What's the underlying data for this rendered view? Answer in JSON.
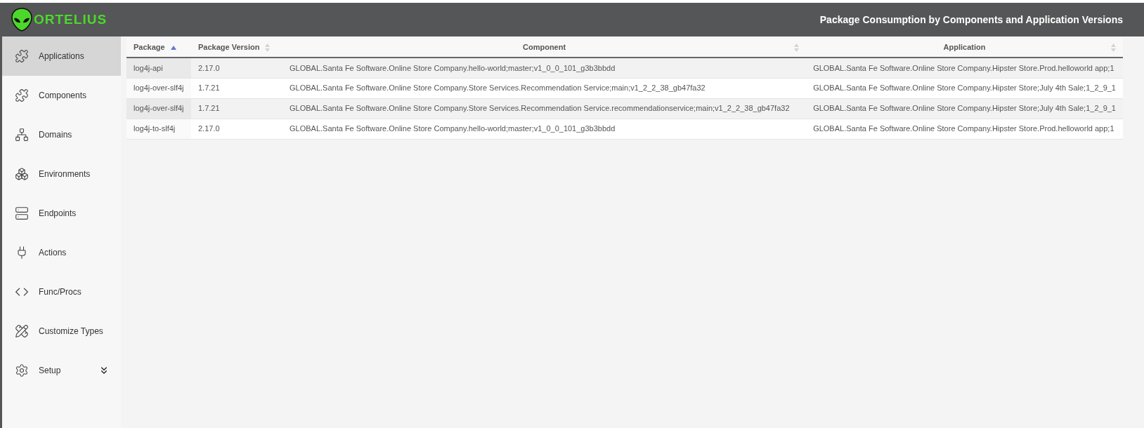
{
  "logo": {
    "text": "ORTELIUS"
  },
  "header": {
    "title": "Package Consumption by Components and Application Versions"
  },
  "sidebar": {
    "items": [
      {
        "kind": "applications",
        "label": "Applications",
        "selected": true
      },
      {
        "kind": "components",
        "label": "Components",
        "selected": false
      },
      {
        "kind": "domains",
        "label": "Domains",
        "selected": false
      },
      {
        "kind": "environments",
        "label": "Environments",
        "selected": false
      },
      {
        "kind": "endpoints",
        "label": "Endpoints",
        "selected": false
      },
      {
        "kind": "actions",
        "label": "Actions",
        "selected": false
      },
      {
        "kind": "funcprocs",
        "label": "Func/Procs",
        "selected": false
      },
      {
        "kind": "customize",
        "label": "Customize Types",
        "selected": false
      },
      {
        "kind": "setup",
        "label": "Setup",
        "selected": false,
        "expanded": false
      }
    ]
  },
  "table": {
    "columns": [
      {
        "label": "Package",
        "sorted": true
      },
      {
        "label": "Package Version",
        "sorted": false
      },
      {
        "label": "Component",
        "sorted": false
      },
      {
        "label": "Application",
        "sorted": false
      }
    ],
    "rows": [
      [
        "log4j-api",
        "2.17.0",
        "GLOBAL.Santa Fe Software.Online Store Company.hello-world;master;v1_0_0_101_g3b3bbdd",
        "GLOBAL.Santa Fe Software.Online Store Company.Hipster Store.Prod.helloworld app;1"
      ],
      [
        "log4j-over-slf4j",
        "1.7.21",
        "GLOBAL.Santa Fe Software.Online Store Company.Store Services.Recommendation Service;main;v1_2_2_38_gb47fa32",
        "GLOBAL.Santa Fe Software.Online Store Company.Hipster Store;July 4th Sale;1_2_9_1"
      ],
      [
        "log4j-over-slf4j",
        "1.7.21",
        "GLOBAL.Santa Fe Software.Online Store Company.Store Services.Recommendation Service.recommendationservice;main;v1_2_2_38_gb47fa32",
        "GLOBAL.Santa Fe Software.Online Store Company.Hipster Store;July 4th Sale;1_2_9_1"
      ],
      [
        "log4j-to-slf4j",
        "2.17.0",
        "GLOBAL.Santa Fe Software.Online Store Company.hello-world;master;v1_0_0_101_g3b3bbdd",
        "GLOBAL.Santa Fe Software.Online Store Company.Hipster Store.Prod.helloworld app;1"
      ]
    ]
  }
}
